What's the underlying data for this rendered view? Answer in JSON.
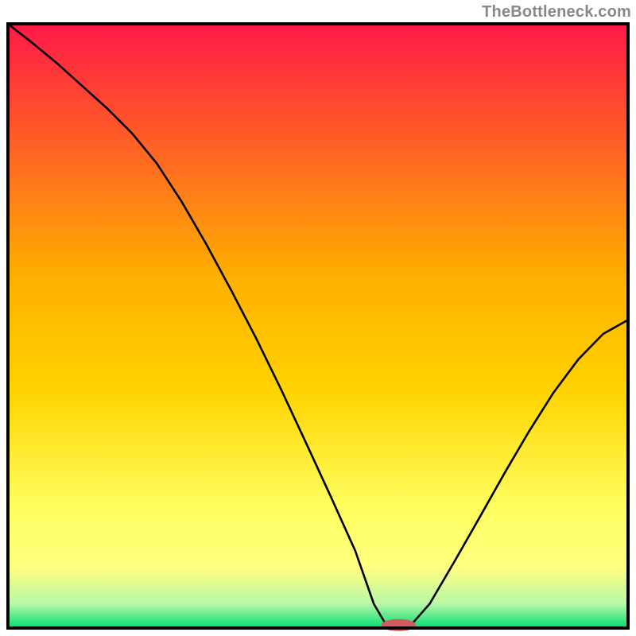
{
  "watermark": {
    "text": "TheBottleneck.com"
  },
  "chart_data": {
    "type": "line",
    "title": "",
    "xlabel": "",
    "ylabel": "",
    "xlim": [
      0,
      100
    ],
    "ylim": [
      0,
      100
    ],
    "gradient_colors": {
      "top": "#ff1947",
      "mid": "#ffd400",
      "lower": "#ffff80",
      "bottom": "#00e070"
    },
    "border_color": "#000000",
    "curve_x": [
      0,
      4,
      8,
      12,
      16,
      20,
      24,
      28,
      32,
      36,
      40,
      44,
      48,
      52,
      56,
      59,
      61,
      63,
      65,
      68,
      72,
      76,
      80,
      84,
      88,
      92,
      96,
      100
    ],
    "curve_y": [
      100,
      96.8,
      93.4,
      89.7,
      86.0,
      81.9,
      76.9,
      70.6,
      63.5,
      55.9,
      48.0,
      39.6,
      30.8,
      21.9,
      12.8,
      4.0,
      0.5,
      0.0,
      0.5,
      4.0,
      11.0,
      18.2,
      25.5,
      32.5,
      39.0,
      44.5,
      48.7,
      51.0
    ],
    "marker": {
      "cx": 63,
      "cy": 0.5,
      "rx": 2.8,
      "ry": 1.0,
      "color": "#ce5c60"
    }
  }
}
